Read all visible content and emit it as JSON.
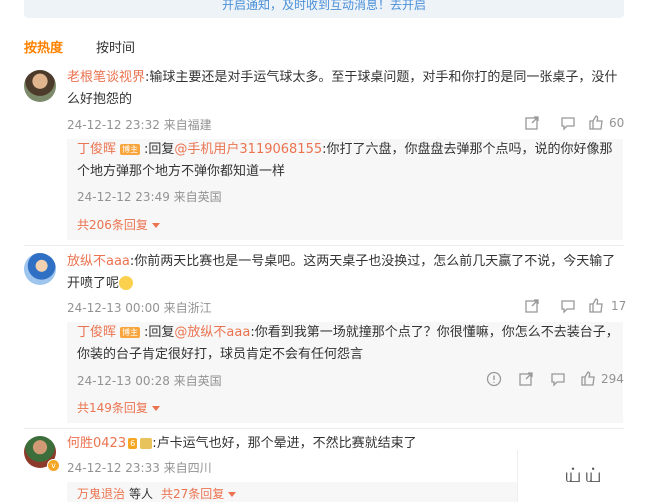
{
  "notice": {
    "text": "开启通知，及时收到互动消息！去开启"
  },
  "sort_tabs": {
    "hot": "按热度",
    "time": "按时间"
  },
  "comments": [
    {
      "user": "老根笔谈视界",
      "text_line1": ":输球主要还是对手运气球太多。至于球桌问题，对手和你打的是同一张桌子，没什",
      "text_line2": "么好抱怨的",
      "meta": "24-12-12 23:32 来自福建",
      "likes": "60",
      "reply": {
        "user": "丁俊晖",
        "badge": "博主",
        "prefix": ":回复",
        "mention": "@手机用户3119068155",
        "text_line1": ":你打了六盘，你盘盘去弹那个点吗，说的你好像那",
        "text_line2": "个地方弹那个地方不弹你都知道一样",
        "meta": "24-12-12 23:49 来自英国"
      },
      "more_replies": "共206条回复"
    },
    {
      "user": "放纵不aaa",
      "text_line1": ":你前两天比赛也是一号桌吧。这两天桌子也没换过，怎么前几天赢了不说，今天输了",
      "text_line2": "开喷了呢",
      "meta": "24-12-13 00:00 来自浙江",
      "likes": "17",
      "reply": {
        "user": "丁俊晖",
        "badge": "博主",
        "prefix": ":回复",
        "mention": "@放纵不aaa",
        "text_line1": ":你看到我第一场就撞那个点了？你很懂嘛，你怎么不去装台子，",
        "text_line2": "你装的台子肯定很好打，球员肯定不会有任何怨言",
        "meta": "24-12-13 00:28 来自英国",
        "likes": "294"
      },
      "more_replies": "共149条回复"
    },
    {
      "user": "何胜0423",
      "level_badge": "6",
      "text_line1": ":卢卡运气也好，那个晕进，不然比赛就结束了",
      "meta": "24-12-12 23:33 来自四川",
      "reply_users": "万鬼退治",
      "reply_users_suffix": "等人",
      "more_replies": "共27条回复"
    }
  ],
  "float_button": {
    "text": "ய்ய்"
  }
}
